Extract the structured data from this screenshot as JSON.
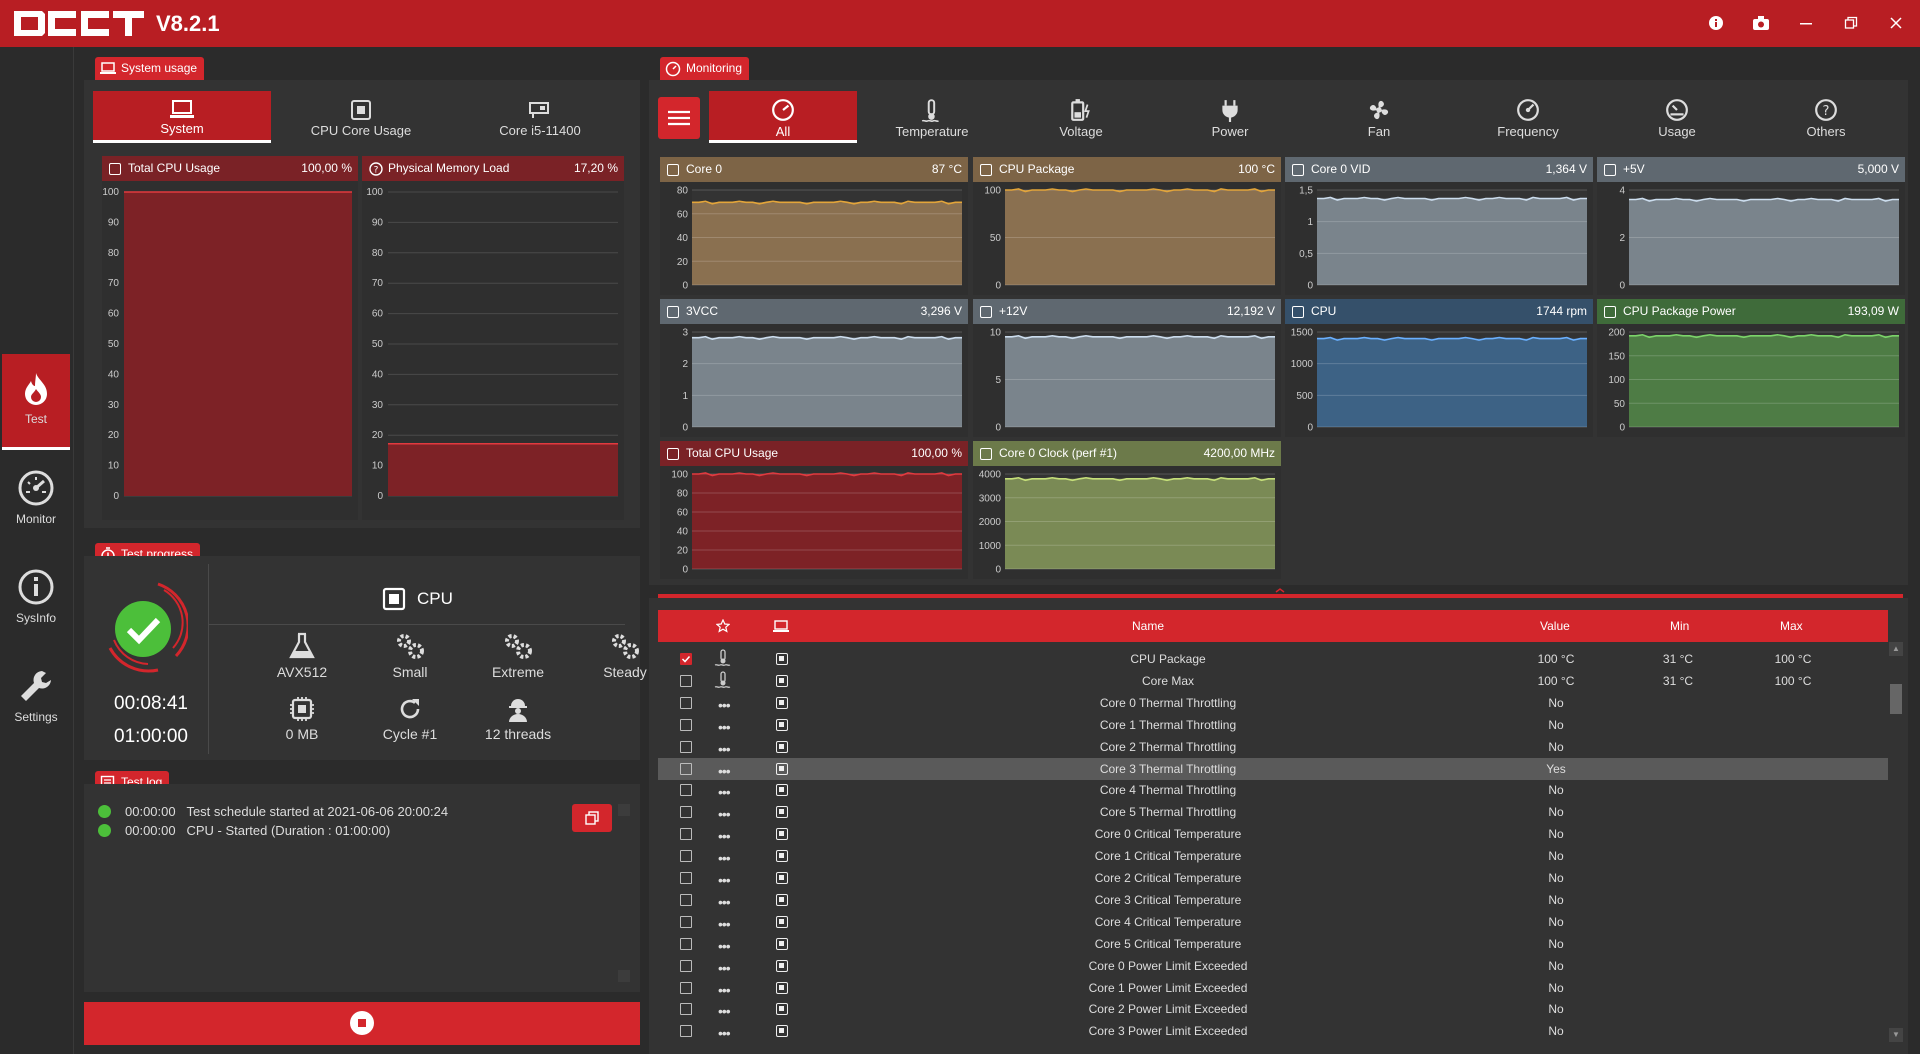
{
  "app": {
    "version": "V8.2.1"
  },
  "sidebar": {
    "items": [
      {
        "label": "Test"
      },
      {
        "label": "Monitor"
      },
      {
        "label": "SysInfo"
      },
      {
        "label": "Settings"
      }
    ]
  },
  "system_usage": {
    "title": "System usage",
    "tabs": [
      {
        "label": "System"
      },
      {
        "label": "CPU Core Usage"
      },
      {
        "label": "Core i5-11400"
      }
    ],
    "graphs": [
      {
        "name": "Total CPU Usage",
        "value": "100,00 %",
        "level": 100
      },
      {
        "name": "Physical Memory Load",
        "value": "17,20 %",
        "level": 17.2
      }
    ],
    "ticks": [
      "100",
      "90",
      "80",
      "70",
      "60",
      "50",
      "40",
      "30",
      "20",
      "10",
      "0"
    ]
  },
  "monitoring": {
    "title": "Monitoring",
    "tabs": [
      {
        "label": "All"
      },
      {
        "label": "Temperature"
      },
      {
        "label": "Voltage"
      },
      {
        "label": "Power"
      },
      {
        "label": "Fan"
      },
      {
        "label": "Frequency"
      },
      {
        "label": "Usage"
      },
      {
        "label": "Others"
      }
    ],
    "graphs": [
      {
        "name": "Core 0",
        "value": "87 °C",
        "ticks": [
          "80",
          "60",
          "40",
          "20",
          "0"
        ],
        "level": 0.87,
        "color": "brown"
      },
      {
        "name": "CPU Package",
        "value": "100 °C",
        "ticks": [
          "100",
          "50",
          "0"
        ],
        "level": 1.0,
        "color": "brown"
      },
      {
        "name": "Core 0 VID",
        "value": "1,364 V",
        "ticks": [
          "1,5",
          "1",
          "0,5",
          "0"
        ],
        "level": 0.91,
        "color": "gray"
      },
      {
        "name": "+5V",
        "value": "5,000 V",
        "ticks": [
          "4",
          "2",
          "0"
        ],
        "level": 0.9,
        "color": "gray"
      },
      {
        "name": "3VCC",
        "value": "3,296 V",
        "ticks": [
          "3",
          "2",
          "1",
          "0"
        ],
        "level": 0.94,
        "color": "gray"
      },
      {
        "name": "+12V",
        "value": "12,192 V",
        "ticks": [
          "10",
          "5",
          "0"
        ],
        "level": 0.95,
        "color": "gray"
      },
      {
        "name": "CPU",
        "value": "1744 rpm",
        "ticks": [
          "1500",
          "1000",
          "500",
          "0"
        ],
        "level": 0.93,
        "color": "blue"
      },
      {
        "name": "CPU Package Power",
        "value": "193,09 W",
        "ticks": [
          "200",
          "150",
          "100",
          "50",
          "0"
        ],
        "level": 0.96,
        "color": "green"
      },
      {
        "name": "Total CPU Usage",
        "value": "100,00 %",
        "ticks": [
          "100",
          "80",
          "60",
          "40",
          "20",
          "0"
        ],
        "level": 1.0,
        "color": "red"
      },
      {
        "name": "Core 0 Clock (perf #1)",
        "value": "4200,00 MHz",
        "ticks": [
          "4000",
          "3000",
          "2000",
          "1000",
          "0"
        ],
        "level": 0.95,
        "color": "olive"
      }
    ]
  },
  "test_progress": {
    "title": "Test progress",
    "test_name": "CPU",
    "elapsed": "00:08:41",
    "duration": "01:00:00",
    "items": [
      {
        "label": "AVX512"
      },
      {
        "label": "Small"
      },
      {
        "label": "Extreme"
      },
      {
        "label": "Steady"
      },
      {
        "label": "0 MB"
      },
      {
        "label": "Cycle #1"
      },
      {
        "label": "12 threads"
      }
    ]
  },
  "test_log": {
    "title": "Test log",
    "entries": [
      {
        "time": "00:00:00",
        "text": "Test schedule started at 2021-06-06 20:00:24"
      },
      {
        "time": "00:00:00",
        "text": "CPU - Started (Duration : 01:00:00)"
      }
    ]
  },
  "table": {
    "columns": {
      "name": "Name",
      "value": "Value",
      "min": "Min",
      "max": "Max"
    },
    "rows": [
      {
        "name": "CPU Package",
        "value": "100 °C",
        "min": "31 °C",
        "max": "100 °C",
        "checked": true,
        "icon": "temperature-icon"
      },
      {
        "name": "Core Max",
        "value": "100 °C",
        "min": "31 °C",
        "max": "100 °C",
        "checked": false,
        "icon": "temperature-icon"
      },
      {
        "name": "Core 0 Thermal Throttling",
        "value": "No",
        "min": "",
        "max": ""
      },
      {
        "name": "Core 1 Thermal Throttling",
        "value": "No",
        "min": "",
        "max": ""
      },
      {
        "name": "Core 2 Thermal Throttling",
        "value": "No",
        "min": "",
        "max": ""
      },
      {
        "name": "Core 3 Thermal Throttling",
        "value": "Yes",
        "min": "",
        "max": "",
        "selected": true
      },
      {
        "name": "Core 4 Thermal Throttling",
        "value": "No",
        "min": "",
        "max": ""
      },
      {
        "name": "Core 5 Thermal Throttling",
        "value": "No",
        "min": "",
        "max": ""
      },
      {
        "name": "Core 0 Critical Temperature",
        "value": "No",
        "min": "",
        "max": ""
      },
      {
        "name": "Core 1 Critical Temperature",
        "value": "No",
        "min": "",
        "max": ""
      },
      {
        "name": "Core 2 Critical Temperature",
        "value": "No",
        "min": "",
        "max": ""
      },
      {
        "name": "Core 3 Critical Temperature",
        "value": "No",
        "min": "",
        "max": ""
      },
      {
        "name": "Core 4 Critical Temperature",
        "value": "No",
        "min": "",
        "max": ""
      },
      {
        "name": "Core 5 Critical Temperature",
        "value": "No",
        "min": "",
        "max": ""
      },
      {
        "name": "Core 0 Power Limit Exceeded",
        "value": "No",
        "min": "",
        "max": ""
      },
      {
        "name": "Core 1 Power Limit Exceeded",
        "value": "No",
        "min": "",
        "max": ""
      },
      {
        "name": "Core 2 Power Limit Exceeded",
        "value": "No",
        "min": "",
        "max": ""
      },
      {
        "name": "Core 3 Power Limit Exceeded",
        "value": "No",
        "min": "",
        "max": ""
      }
    ]
  },
  "colors": {
    "accent": "#d3262c",
    "title_bar": "#b81e23",
    "success": "#4cbf3a"
  }
}
